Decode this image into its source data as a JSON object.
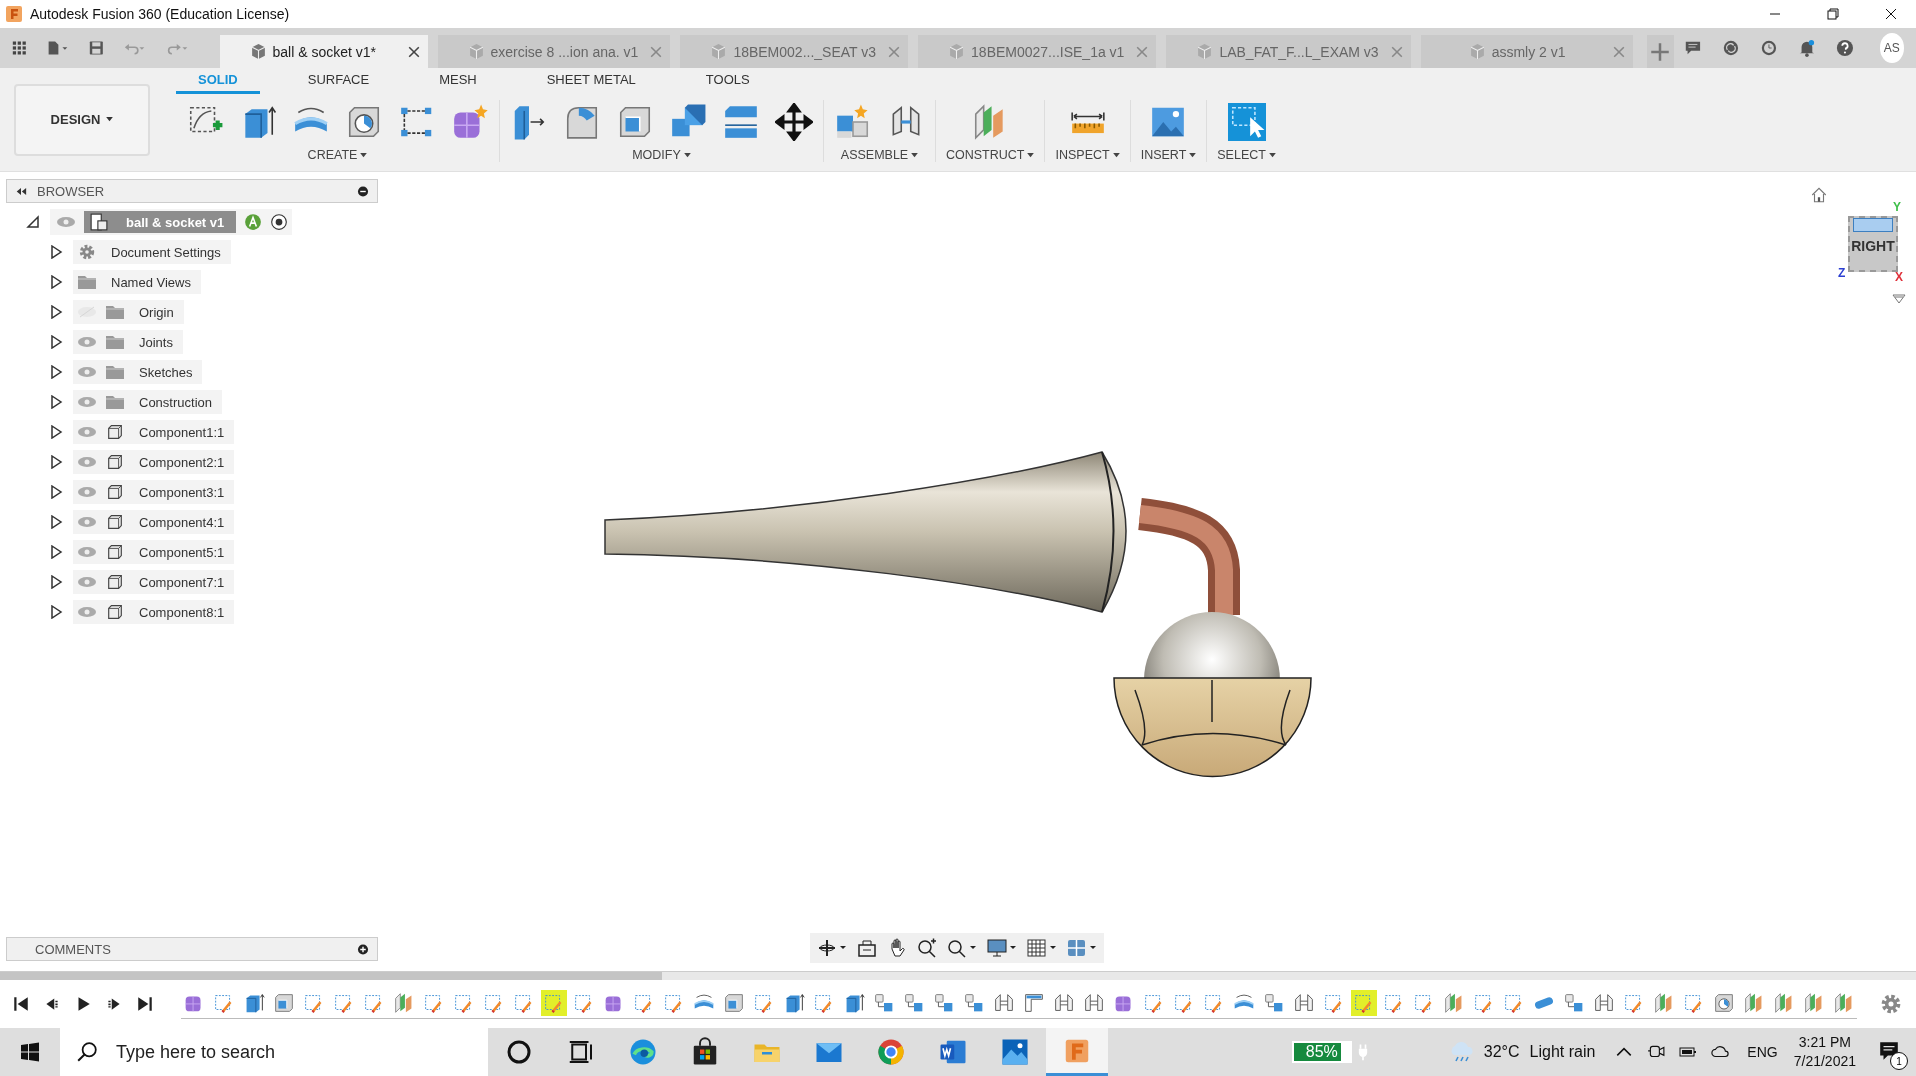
{
  "window": {
    "title": "Autodesk Fusion 360 (Education License)"
  },
  "doc_tabs": [
    {
      "label": "ball & socket v1*",
      "selected": true
    },
    {
      "label": "exercise 8 ...ion ana. v1",
      "selected": false
    },
    {
      "label": "18BEM002..._SEAT v3",
      "selected": false
    },
    {
      "label": "18BEM0027...ISE_1a v1",
      "selected": false
    },
    {
      "label": "LAB_FAT_F...L_EXAM v3",
      "selected": false
    },
    {
      "label": "assmly 2 v1",
      "selected": false
    }
  ],
  "user": {
    "initials": "AS"
  },
  "workspace": {
    "label": "DESIGN"
  },
  "tool_tabs": [
    {
      "label": "SOLID",
      "selected": true
    },
    {
      "label": "SURFACE",
      "selected": false
    },
    {
      "label": "MESH",
      "selected": false
    },
    {
      "label": "SHEET METAL",
      "selected": false
    },
    {
      "label": "TOOLS",
      "selected": false
    }
  ],
  "tool_groups": [
    {
      "label": "CREATE",
      "tools": [
        {
          "kind": "sketch"
        },
        {
          "kind": "extrude"
        },
        {
          "kind": "revolve"
        },
        {
          "kind": "hole"
        },
        {
          "kind": "pattern"
        },
        {
          "kind": "form"
        }
      ]
    },
    {
      "label": "MODIFY",
      "tools": [
        {
          "kind": "presspull"
        },
        {
          "kind": "fillet"
        },
        {
          "kind": "shell"
        },
        {
          "kind": "combine"
        },
        {
          "kind": "split"
        },
        {
          "kind": "move"
        }
      ]
    },
    {
      "label": "ASSEMBLE",
      "tools": [
        {
          "kind": "newcomp"
        },
        {
          "kind": "joint"
        }
      ]
    },
    {
      "label": "CONSTRUCT",
      "tools": [
        {
          "kind": "plane"
        }
      ]
    },
    {
      "label": "INSPECT",
      "tools": [
        {
          "kind": "measure"
        }
      ]
    },
    {
      "label": "INSERT",
      "tools": [
        {
          "kind": "image"
        }
      ]
    },
    {
      "label": "SELECT",
      "tools": [
        {
          "kind": "select"
        }
      ]
    }
  ],
  "browser": {
    "title": "BROWSER",
    "root": {
      "label": "ball & socket v1",
      "expanded": true,
      "visible": true,
      "children": [
        {
          "label": "Document Settings",
          "kind": "settings",
          "expanded": false
        },
        {
          "label": "Named Views",
          "kind": "folder",
          "expanded": false
        },
        {
          "label": "Origin",
          "kind": "folder",
          "expanded": false,
          "visible": false
        },
        {
          "label": "Joints",
          "kind": "folder",
          "expanded": false,
          "visible": true
        },
        {
          "label": "Sketches",
          "kind": "folder",
          "expanded": false,
          "visible": true
        },
        {
          "label": "Construction",
          "kind": "folder",
          "expanded": false,
          "visible": true
        },
        {
          "label": "Component1:1",
          "kind": "component",
          "expanded": false,
          "visible": true
        },
        {
          "label": "Component2:1",
          "kind": "component",
          "expanded": false,
          "visible": true
        },
        {
          "label": "Component3:1",
          "kind": "component",
          "expanded": false,
          "visible": true
        },
        {
          "label": "Component4:1",
          "kind": "component",
          "expanded": false,
          "visible": true
        },
        {
          "label": "Component5:1",
          "kind": "component",
          "expanded": false,
          "visible": true
        },
        {
          "label": "Component7:1",
          "kind": "component",
          "expanded": false,
          "visible": true
        },
        {
          "label": "Component8:1",
          "kind": "component",
          "expanded": false,
          "visible": true
        }
      ]
    }
  },
  "viewcube": {
    "face": "RIGHT",
    "axis_y": "Y",
    "axis_z": "Z",
    "axis_x": "X"
  },
  "comments": {
    "title": "COMMENTS"
  },
  "timeline": [
    {
      "kind": "box",
      "selected": false
    },
    {
      "kind": "sketch",
      "selected": false
    },
    {
      "kind": "extrude",
      "selected": false
    },
    {
      "kind": "shell",
      "selected": false
    },
    {
      "kind": "sketch",
      "selected": false
    },
    {
      "kind": "sketch",
      "selected": false
    },
    {
      "kind": "sketch",
      "selected": false
    },
    {
      "kind": "plane",
      "selected": false
    },
    {
      "kind": "sketch",
      "selected": false
    },
    {
      "kind": "sketch",
      "selected": false
    },
    {
      "kind": "sketch",
      "selected": false
    },
    {
      "kind": "sketch",
      "selected": false
    },
    {
      "kind": "sketch",
      "selected": true
    },
    {
      "kind": "sketch",
      "selected": false
    },
    {
      "kind": "box",
      "selected": false
    },
    {
      "kind": "sketch",
      "selected": false
    },
    {
      "kind": "sketch",
      "selected": false
    },
    {
      "kind": "revolve",
      "selected": false
    },
    {
      "kind": "shell",
      "selected": false
    },
    {
      "kind": "sketch",
      "selected": false
    },
    {
      "kind": "extrude",
      "selected": false
    },
    {
      "kind": "sketch",
      "selected": false
    },
    {
      "kind": "extrude",
      "selected": false
    },
    {
      "kind": "joint",
      "selected": false
    },
    {
      "kind": "joint",
      "selected": false
    },
    {
      "kind": "joint",
      "selected": false
    },
    {
      "kind": "joint",
      "selected": false
    },
    {
      "kind": "rigid",
      "selected": false
    },
    {
      "kind": "tee",
      "selected": false
    },
    {
      "kind": "rigid",
      "selected": false
    },
    {
      "kind": "rigid",
      "selected": false
    },
    {
      "kind": "box",
      "selected": false
    },
    {
      "kind": "sketch",
      "selected": false
    },
    {
      "kind": "sketch",
      "selected": false
    },
    {
      "kind": "sketch",
      "selected": false
    },
    {
      "kind": "revolve",
      "selected": false
    },
    {
      "kind": "joint",
      "selected": false
    },
    {
      "kind": "rigid",
      "selected": false
    },
    {
      "kind": "sketch",
      "selected": false
    },
    {
      "kind": "sketch",
      "selected": true
    },
    {
      "kind": "sketch",
      "selected": false
    },
    {
      "kind": "sketch",
      "selected": false
    },
    {
      "kind": "plane",
      "selected": false
    },
    {
      "kind": "sketch",
      "selected": false
    },
    {
      "kind": "sketch",
      "selected": false
    },
    {
      "kind": "pill",
      "selected": false
    },
    {
      "kind": "joint",
      "selected": false
    },
    {
      "kind": "rigid",
      "selected": false
    },
    {
      "kind": "sketch",
      "selected": false
    },
    {
      "kind": "plane",
      "selected": false
    },
    {
      "kind": "sketch",
      "selected": false
    },
    {
      "kind": "hole",
      "selected": false
    },
    {
      "kind": "plane",
      "selected": false
    },
    {
      "kind": "plane",
      "selected": false
    },
    {
      "kind": "plane",
      "selected": false
    },
    {
      "kind": "plane",
      "selected": false
    }
  ],
  "taskbar": {
    "search": {
      "placeholder": "Type here to search"
    },
    "apps": [
      {
        "kind": "cortana",
        "selected": false
      },
      {
        "kind": "taskview",
        "selected": false
      },
      {
        "kind": "edge",
        "selected": false
      },
      {
        "kind": "store",
        "selected": false
      },
      {
        "kind": "explorer",
        "selected": false
      },
      {
        "kind": "mail",
        "selected": false
      },
      {
        "kind": "chrome",
        "selected": false
      },
      {
        "kind": "word",
        "selected": false
      },
      {
        "kind": "photos",
        "selected": false
      },
      {
        "kind": "fusion",
        "selected": true
      }
    ],
    "battery": {
      "reading": "85%",
      "level": 0.85
    },
    "weather": {
      "temperature": "32°C",
      "condition": "Light rain"
    },
    "language": "ENG",
    "time": "3:21 PM",
    "date": "7/21/2021",
    "notifications": "1"
  }
}
